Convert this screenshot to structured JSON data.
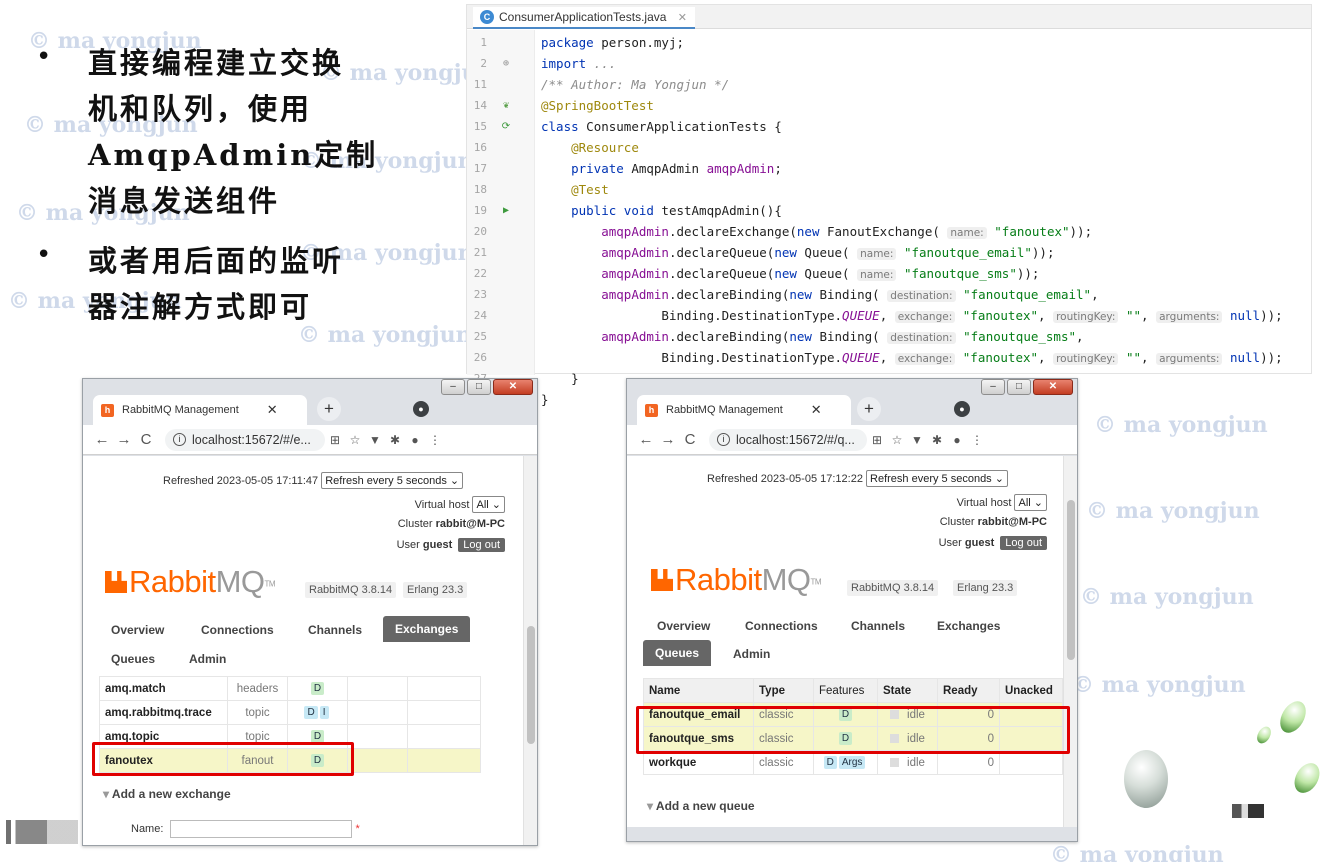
{
  "watermark": "© ma yongjun",
  "slide": {
    "bullets": [
      "直接编程建立交换\n机和队列，使用\nAmqpAdmin定制\n消息发送组件",
      "或者用后面的监听\n器注解方式即可"
    ]
  },
  "ide": {
    "tab_label": "ConsumerApplicationTests.java",
    "line_numbers": [
      "1",
      "2",
      "11",
      "14",
      "15",
      "16",
      "17",
      "18",
      "19",
      "20",
      "21",
      "22",
      "23",
      "24",
      "25",
      "26",
      "27",
      "28"
    ],
    "code": {
      "l1_kw": "package",
      "l1_rest": " person.myj;",
      "l2_kw": "import",
      "l2_rest": " ...",
      "l3": "/** Author: Ma Yongjun */",
      "l4": "@SpringBootTest",
      "l5_kw": "class",
      "l5_rest": " ConsumerApplicationTests {",
      "l6": "@Resource",
      "l7_kw": "private",
      "l7_type": " AmqpAdmin ",
      "l7_field": "amqpAdmin",
      "l7_end": ";",
      "l8": "@Test",
      "l9_kw": "public void",
      "l9_rest": " testAmqpAdmin(){",
      "amqp": "amqpAdmin",
      "declareExchange": ".declareExchange(",
      "declareQueue": ".declareQueue(",
      "declareBinding": ".declareBinding(",
      "new": "new",
      "fanoutExchange": " FanoutExchange( ",
      "queue": " Queue( ",
      "binding": " Binding( ",
      "hint_name": "name:",
      "hint_destination": "destination:",
      "hint_exchange": "exchange:",
      "hint_routingKey": "routingKey:",
      "hint_arguments": "arguments:",
      "str_fanoutex": "\"fanoutex\"",
      "str_email": "\"fanoutque_email\"",
      "str_sms": "\"fanoutque_sms\"",
      "str_empty": "\"\"",
      "null": "null",
      "close2": "));",
      "comma": ",",
      "comma_sp": ", ",
      "dest_type": "Binding.DestinationType.",
      "queue_const": "QUEUE",
      "brace_close": "}"
    }
  },
  "browser_left": {
    "tab_title": "RabbitMQ Management",
    "url": "localhost:15672/#/e...",
    "refreshed": "Refreshed 2023-05-05 17:11:47",
    "refresh_select": "Refresh every 5 seconds",
    "virtual_host_label": "Virtual host",
    "virtual_host_value": "All",
    "cluster_label": "Cluster",
    "cluster_value": "rabbit@M-PC",
    "user_label": "User",
    "user_value": "guest",
    "logout": "Log out",
    "version_rabbitmq": "RabbitMQ 3.8.14",
    "version_erlang": "Erlang 23.3",
    "nav": [
      "Overview",
      "Connections",
      "Channels",
      "Exchanges",
      "Queues",
      "Admin"
    ],
    "active_nav": "Exchanges",
    "rows": [
      {
        "name": "amq.match",
        "type": "headers",
        "features": [
          "D"
        ]
      },
      {
        "name": "amq.rabbitmq.trace",
        "type": "topic",
        "features": [
          "D",
          "I"
        ]
      },
      {
        "name": "amq.topic",
        "type": "topic",
        "features": [
          "D"
        ]
      },
      {
        "name": "fanoutex",
        "type": "fanout",
        "features": [
          "D"
        ]
      }
    ],
    "add_new": "Add a new exchange",
    "name_label": "Name:",
    "name_value": "",
    "required_mark": "*"
  },
  "browser_right": {
    "tab_title": "RabbitMQ Management",
    "url": "localhost:15672/#/q...",
    "refreshed": "Refreshed 2023-05-05 17:12:22",
    "refresh_select": "Refresh every 5 seconds",
    "virtual_host_label": "Virtual host",
    "virtual_host_value": "All",
    "cluster_label": "Cluster",
    "cluster_value": "rabbit@M-PC",
    "user_label": "User",
    "user_value": "guest",
    "logout": "Log out",
    "version_rabbitmq": "RabbitMQ 3.8.14",
    "version_erlang": "Erlang 23.3",
    "nav": [
      "Overview",
      "Connections",
      "Channels",
      "Exchanges",
      "Queues",
      "Admin"
    ],
    "active_nav": "Queues",
    "columns": [
      "Name",
      "Type",
      "Features",
      "State",
      "Ready",
      "Unacked"
    ],
    "rows": [
      {
        "name": "fanoutque_email",
        "type": "classic",
        "features": [
          "D"
        ],
        "state": "idle",
        "ready": "0"
      },
      {
        "name": "fanoutque_sms",
        "type": "classic",
        "features": [
          "D"
        ],
        "state": "idle",
        "ready": "0"
      },
      {
        "name": "workque",
        "type": "classic",
        "features": [
          "D",
          "Args"
        ],
        "state": "idle",
        "ready": "0"
      }
    ],
    "add_new": "Add a new queue"
  },
  "colors": {
    "accent_orange": "#ff6600",
    "highlight_red": "#e00000",
    "row_highlight": "#f6f6c8",
    "active_tab": "#666666"
  }
}
